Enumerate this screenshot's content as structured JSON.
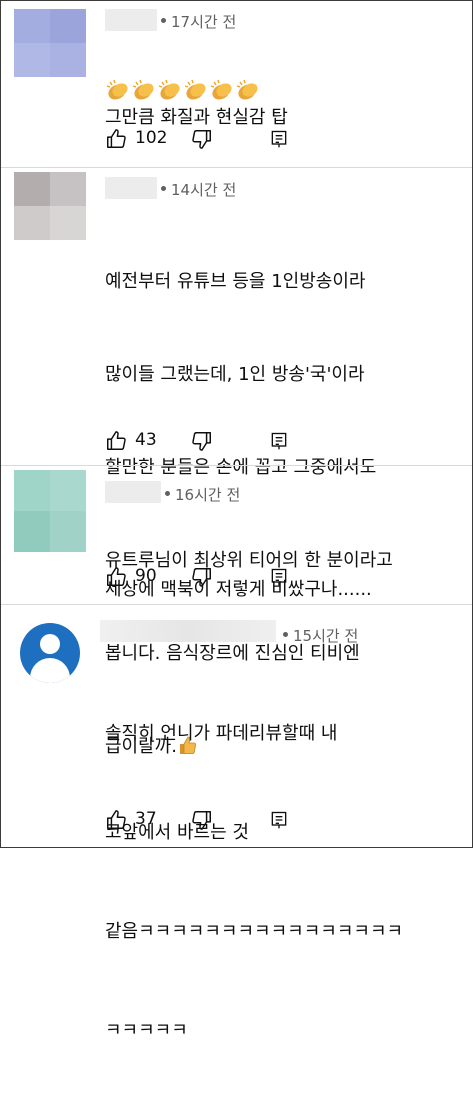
{
  "comments": [
    {
      "time": "17시간 전",
      "lines": [
        "그만큼 화질과 현실감 탑"
      ],
      "emoji_line": "👏👏👏👏👏👏",
      "likes": "102",
      "avatar_colors": [
        "#a3addf",
        "#9ba5dc",
        "#b0b8e6",
        "#a9b2e3"
      ]
    },
    {
      "time": "14시간 전",
      "lines": [
        "예전부터 유튜브 등을 1인방송이라",
        "많이들 그랬는데, 1인 방송'국'이라",
        "할만한 분들은 손에 꼽고 그중에서도",
        "유트루님이 최상위 티어의 한 분이라고",
        "봅니다. 음식장르에 진심인 티비엔",
        "급이랄까."
      ],
      "trailing_emoji": "👍",
      "likes": "43",
      "avatar_colors": [
        "#b3adae",
        "#c6c2c3",
        "#cfcbcb",
        "#d8d5d5"
      ]
    },
    {
      "time": "16시간 전",
      "lines": [
        "세상에 맥북이 저렇게 비쌌구나......"
      ],
      "likes": "90",
      "avatar_colors": [
        "#9fd4c8",
        "#a9d9ce",
        "#90cbbd",
        "#a1d2c7"
      ]
    },
    {
      "time": "15시간 전",
      "lines": [
        "솔직히 언니가 파데리뷰할때 내",
        "코앞에서 바르는 것",
        "같음ㅋㅋㅋㅋㅋㅋㅋㅋㅋㅋㅋㅋㅋㅋㅋㅋ",
        "ㅋㅋㅋㅋㅋ"
      ],
      "likes": "37"
    }
  ],
  "icons": {
    "like": "thumbs-up-icon",
    "dislike": "thumbs-down-icon",
    "reply": "reply-comment-icon",
    "avatar": "default-user-avatar-icon"
  },
  "colors": {
    "text": "#0f0f0f",
    "meta": "#606060",
    "avatar_default": "#1e6fc0",
    "separator": "#d9d9d9"
  }
}
